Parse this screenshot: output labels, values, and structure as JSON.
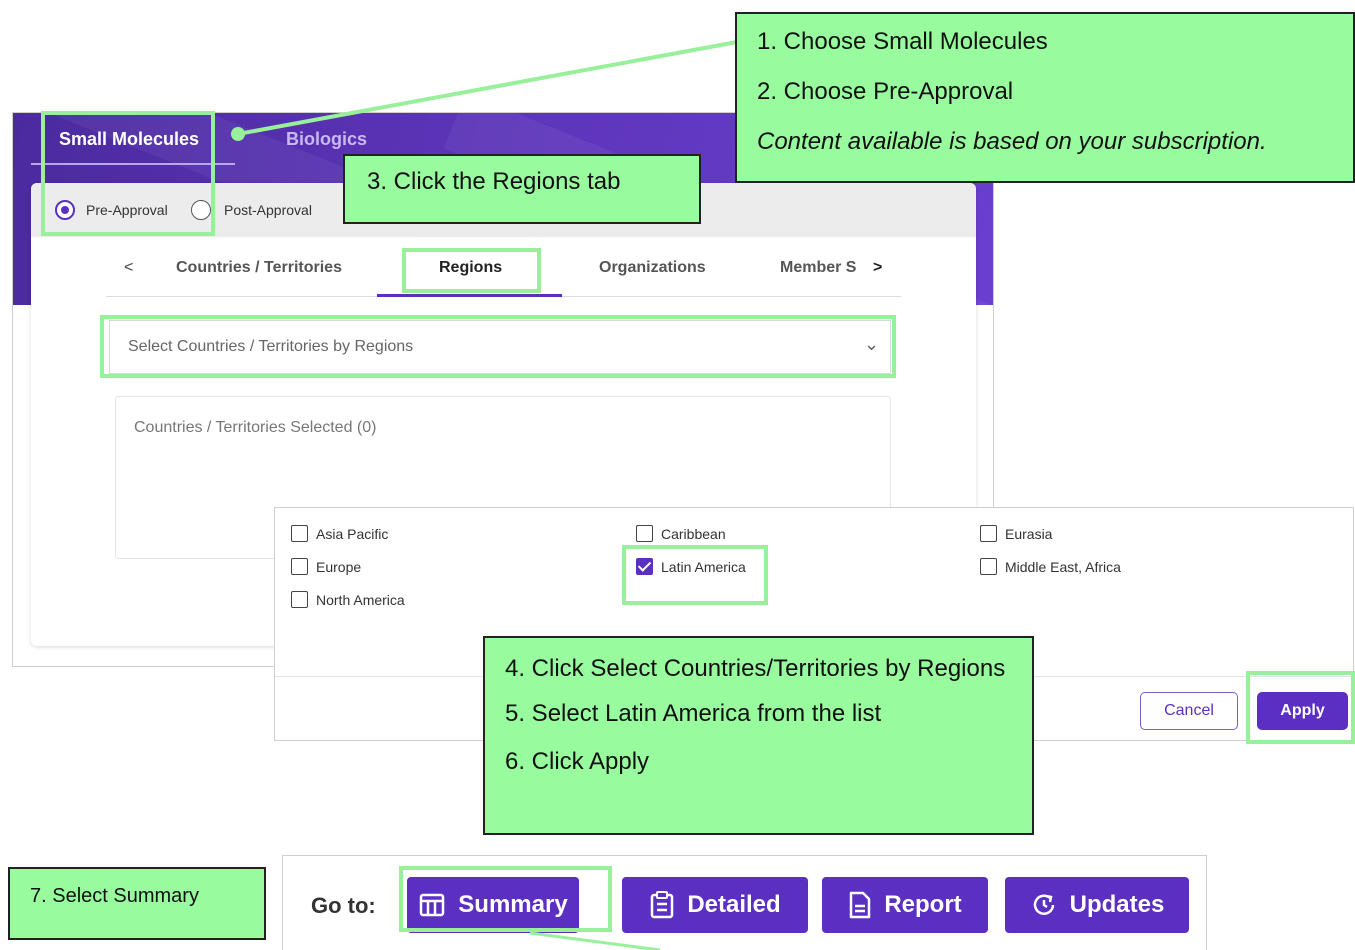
{
  "top_tabs": {
    "small_molecules": "Small Molecules",
    "biologics": "Biologics"
  },
  "approval": {
    "pre": "Pre-Approval",
    "post": "Post-Approval",
    "selected": "pre"
  },
  "nav_tabs": {
    "prev": "<",
    "countries": "Countries / Territories",
    "regions": "Regions",
    "organizations": "Organizations",
    "member": "Member S",
    "next": ">"
  },
  "select": {
    "placeholder": "Select Countries / Territories by Regions"
  },
  "selected_box": {
    "label": "Countries / Territories Selected (0)"
  },
  "regions": [
    {
      "label": "Asia Pacific",
      "checked": false
    },
    {
      "label": "Caribbean",
      "checked": false
    },
    {
      "label": "Eurasia",
      "checked": false
    },
    {
      "label": "Europe",
      "checked": false
    },
    {
      "label": "Latin America",
      "checked": true
    },
    {
      "label": "Middle East, Africa",
      "checked": false
    },
    {
      "label": "North America",
      "checked": false
    }
  ],
  "popup_buttons": {
    "cancel": "Cancel",
    "apply": "Apply"
  },
  "goto": {
    "label": "Go to:",
    "summary": "Summary",
    "detailed": "Detailed",
    "report": "Report",
    "updates": "Updates"
  },
  "annotations": {
    "step1": "1. Choose Small Molecules",
    "step2": "2. Choose Pre-Approval",
    "note_subscription": "Content available is based on your subscription.",
    "step3": "3. Click the Regions tab",
    "step4": "4. Click Select Countries/Territories by Regions",
    "step5": "5. Select Latin America from the list",
    "step6": "6. Click Apply",
    "step7": "7. Select Summary"
  },
  "colors": {
    "accent": "#5b2fc1",
    "highlight": "#98fc9f"
  }
}
